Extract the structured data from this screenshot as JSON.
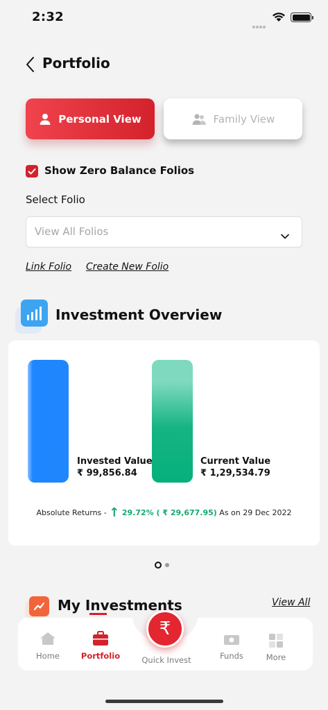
{
  "status": {
    "time": "2:32"
  },
  "header": {
    "title": "Portfolio"
  },
  "view_toggle": {
    "personal": "Personal View",
    "family": "Family View"
  },
  "zero_balance": {
    "label": "Show Zero Balance Folios",
    "checked": true
  },
  "folio": {
    "label": "Select Folio",
    "value": "View All Folios",
    "link_folio": "Link Folio",
    "create_folio": "Create New Folio"
  },
  "overview": {
    "title": "Investment Overview",
    "invested_label": "Invested Value",
    "invested_value": "₹ 99,856.84",
    "current_label": "Current Value",
    "current_value": "₹ 1,29,534.79",
    "returns_prefix": "Absolute Returns -",
    "returns_value": "29.72% ( ₹ 29,677.95)",
    "returns_suffix": "As on 29 Dec 2022"
  },
  "chart_data": {
    "type": "bar",
    "categories": [
      "Invested Value",
      "Current Value"
    ],
    "values": [
      99856.84,
      129534.79
    ]
  },
  "my_investments": {
    "title": "My Investments",
    "view_all": "View All"
  },
  "nav": {
    "home": "Home",
    "portfolio": "Portfolio",
    "quick_invest": "Quick Invest",
    "funds": "Funds",
    "more": "More",
    "rupee": "₹"
  },
  "colors": {
    "accent": "#d3222b",
    "invested": "#1f86fe",
    "current": "#06b07b",
    "positive": "#16a86e"
  }
}
